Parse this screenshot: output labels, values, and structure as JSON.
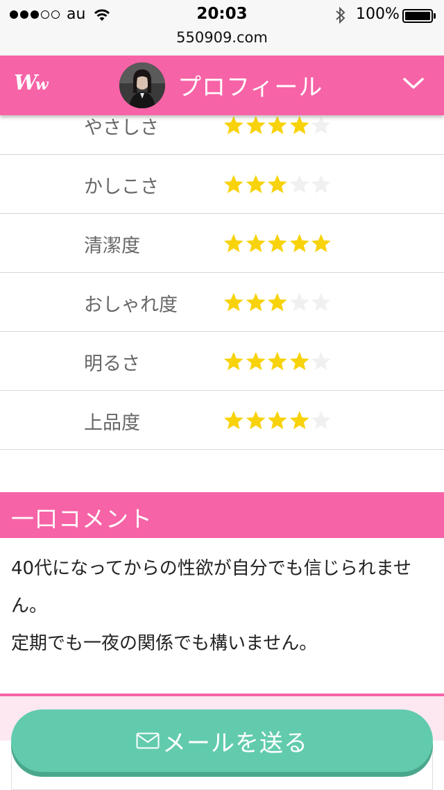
{
  "status_bar": {
    "carrier": "au",
    "time": "20:03",
    "battery": "100%",
    "url": "550909.com"
  },
  "header": {
    "logo": "Ww",
    "title": "プロフィール"
  },
  "ratings": [
    {
      "label": "やさしさ",
      "stars": 4
    },
    {
      "label": "かしこさ",
      "stars": 3
    },
    {
      "label": "清潔度",
      "stars": 5
    },
    {
      "label": "おしゃれ度",
      "stars": 3
    },
    {
      "label": "明るさ",
      "stars": 4
    },
    {
      "label": "上品度",
      "stars": 4
    }
  ],
  "comment": {
    "title": "一口コメント",
    "lines": [
      "40代になってからの性欲が自分でも信じられません。",
      "定期でも一夜の関係でも構いません。"
    ]
  },
  "bottom": {
    "mail_button": "メールを送る"
  },
  "colors": {
    "brand_pink": "#f763a7",
    "star_on": "#f8d20a",
    "star_off": "#f0f0f0",
    "button_green": "#62cbad"
  }
}
